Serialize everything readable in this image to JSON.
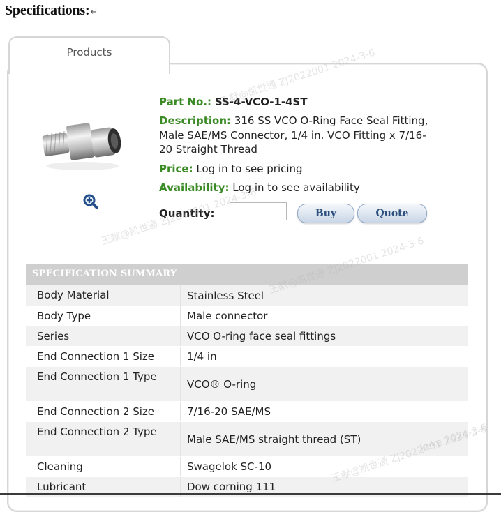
{
  "heading": {
    "text": "Specifications:",
    "mark": "↵"
  },
  "tab": {
    "label": "Products"
  },
  "product": {
    "part_label": "Part No.:",
    "part_value": "SS-4-VCO-1-4ST",
    "description_label": "Description:",
    "description_value": "316 SS VCO O-Ring Face Seal Fitting, Male SAE/MS Connector, 1/4 in. VCO Fitting x 7/16-20 Straight Thread",
    "price_label": "Price:",
    "price_value": "Log in to see pricing",
    "availability_label": "Availability:",
    "availability_value": "Log in to see availability",
    "quantity_label": "Quantity:",
    "quantity_value": "",
    "buy_label": "Buy",
    "quote_label": "Quote",
    "zoom_icon": "zoom-in-icon"
  },
  "spec": {
    "header": "SPECIFICATION SUMMARY",
    "rows": [
      {
        "key": "Body Material",
        "value": "Stainless Steel"
      },
      {
        "key": "Body Type",
        "value": "Male connector"
      },
      {
        "key": "Series",
        "value": "VCO O-ring face seal fittings"
      },
      {
        "key": "End Connection 1 Size",
        "value": "1/4 in"
      },
      {
        "key": "End Connection 1 Type",
        "value": "VCO® O-ring"
      },
      {
        "key": "End Connection 2 Size",
        "value": "7/16-20 SAE/MS"
      },
      {
        "key": "End Connection 2 Type",
        "value": "Male SAE/MS straight thread (ST)"
      },
      {
        "key": "Cleaning",
        "value": "Swagelok SC-10"
      },
      {
        "key": "Lubricant",
        "value": "Dow corning 111"
      }
    ]
  },
  "watermarks": [
    "王献@凯世通 ZJ2022001 2024-3-6",
    "keke 2024-3-6"
  ],
  "colors": {
    "label_green": "#3a8a25",
    "button_text": "#2c4f7e",
    "header_gray": "#cfcfcf"
  }
}
